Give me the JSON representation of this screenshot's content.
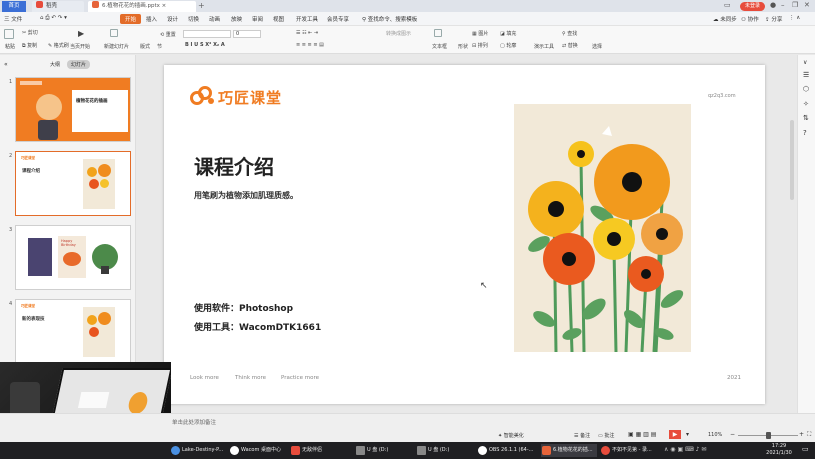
{
  "tabs": {
    "home": "首页",
    "wps": "稻壳",
    "doc": "6.植物花花的插画.pptx"
  },
  "titlebar": {
    "login": "未登录",
    "add": "+"
  },
  "menu": {
    "file": "三 文件",
    "items": [
      "开始",
      "插入",
      "设计",
      "切换",
      "动画",
      "放映",
      "审阅",
      "视图",
      "开发工具",
      "会员专享"
    ],
    "search": "查找命令、搜索模板",
    "right": [
      "未同步",
      "协作",
      "分享"
    ]
  },
  "ribbon": {
    "paste": "粘贴",
    "cut": "剪切",
    "copy": "复制",
    "format": "格式刷",
    "play": "当页开始",
    "new_slide": "新建幻灯片",
    "layout": "版式",
    "section": "节",
    "reset": "重置",
    "font_size": "0",
    "textbox": "文本框",
    "shape": "形状",
    "arrange": "排列",
    "picture": "图片",
    "fill": "填充",
    "outline": "轮廓",
    "presenter": "演示工具",
    "find": "查找",
    "replace": "替换",
    "select": "选择",
    "convert": "转换成图示"
  },
  "leftpanel": {
    "tab_outline": "大纲",
    "tab_slides": "幻灯片",
    "numbers": [
      "1",
      "2",
      "3",
      "4"
    ]
  },
  "thumbs": {
    "t1_title": "植物花花的插画",
    "t2_title": "课程介绍",
    "t3_title": "Happy Birthday",
    "t4_title": "新的表现技"
  },
  "slide": {
    "logo_text": "巧匠课堂",
    "site": "qz2q3.com",
    "title": "课程介绍",
    "subtitle": "用笔刷为植物添加肌理质感。",
    "software": "使用软件：Photoshop",
    "tool": "使用工具：WacomDTK1661",
    "footer_links": [
      "Look more",
      "Think more",
      "Practice more"
    ],
    "year": "2021"
  },
  "statusbar": {
    "notes": "单击此处添加备注",
    "beautify": "智能美化",
    "notes_btn": "备注",
    "comments": "批注",
    "zoom": "110%"
  },
  "taskbar": {
    "items": [
      "Lake-Destiny-P...",
      "Wacom 桌面中心",
      "无敌伴侣",
      "U 盘 (D:)",
      "U 盘 (D:)",
      "OBS 26.1.1 (64-...",
      "6.植物花花的插...",
      "不如不见第 - 录..."
    ],
    "time": "17:29",
    "date": "2021/1/30"
  },
  "colors": {
    "accent": "#e36c29",
    "brand": "#f07c22",
    "taskbar": "#1f1f22",
    "artbg": "#f2e9d8"
  }
}
